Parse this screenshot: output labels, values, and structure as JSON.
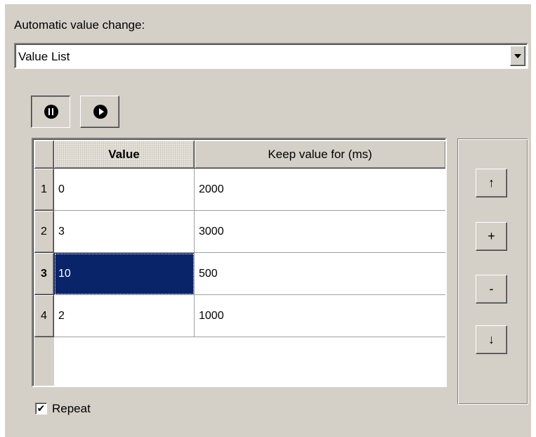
{
  "header": {
    "label": "Automatic value change:"
  },
  "mode_dropdown": {
    "value": "Value List",
    "arrow_icon": "chevron-down-icon"
  },
  "transport": {
    "pause": {
      "icon": "pause-icon",
      "pressed": true
    },
    "play": {
      "icon": "play-icon",
      "pressed": false
    }
  },
  "grid": {
    "columns": [
      "Value",
      "Keep value for (ms)"
    ],
    "rows": [
      {
        "num": "1",
        "value": "0",
        "keep": "2000"
      },
      {
        "num": "2",
        "value": "3",
        "keep": "3000"
      },
      {
        "num": "3",
        "value": "10",
        "keep": "500"
      },
      {
        "num": "4",
        "value": "2",
        "keep": "1000"
      }
    ],
    "selected_row": 3,
    "selection_color": "#0a246a"
  },
  "side_buttons": {
    "move_up": "↑",
    "add": "+",
    "remove": "-",
    "move_down": "↓"
  },
  "repeat": {
    "label": "Repeat",
    "checked": true,
    "check_mark": "✔"
  }
}
